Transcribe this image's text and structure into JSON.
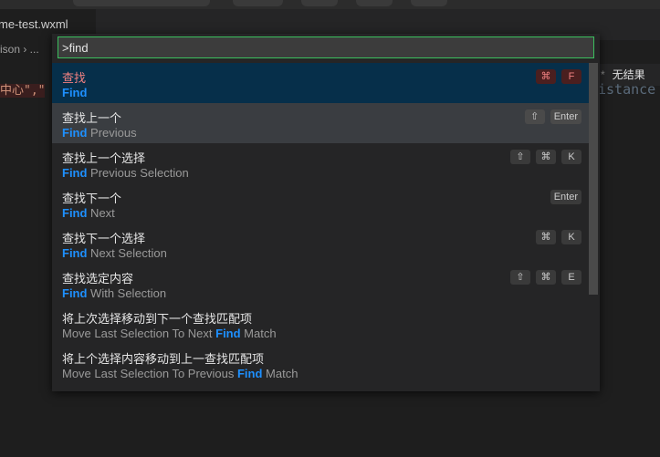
{
  "tab": {
    "label": "me-test.wxml"
  },
  "breadcrumb": {
    "label": "ison ›  ..."
  },
  "editor": {
    "code_fragment": "中心\",\"",
    "right_code": "istance"
  },
  "find_widget": {
    "no_result": "无结果"
  },
  "palette": {
    "query": ">find",
    "items": [
      {
        "title": "查找",
        "sub_prefix": "",
        "sub_hl": "Find",
        "sub_suffix": "",
        "keys": [
          "⌘",
          "F"
        ]
      },
      {
        "title": "查找上一个",
        "sub_prefix": "",
        "sub_hl": "Find",
        "sub_suffix": " Previous",
        "keys": [
          "⇧",
          "Enter"
        ]
      },
      {
        "title": "查找上一个选择",
        "sub_prefix": "",
        "sub_hl": "Find",
        "sub_suffix": " Previous Selection",
        "keys": [
          "⇧",
          "⌘",
          "K"
        ]
      },
      {
        "title": "查找下一个",
        "sub_prefix": "",
        "sub_hl": "Find",
        "sub_suffix": " Next",
        "keys": [
          "Enter"
        ]
      },
      {
        "title": "查找下一个选择",
        "sub_prefix": "",
        "sub_hl": "Find",
        "sub_suffix": " Next Selection",
        "keys": [
          "⌘",
          "K"
        ]
      },
      {
        "title": "查找选定内容",
        "sub_prefix": "",
        "sub_hl": "Find",
        "sub_suffix": " With Selection",
        "keys": [
          "⇧",
          "⌘",
          "E"
        ]
      },
      {
        "title": "将上次选择移动到下一个查找匹配项",
        "sub_prefix": "Move Last Selection To Next ",
        "sub_hl": "Find",
        "sub_suffix": " Match",
        "keys": []
      },
      {
        "title": "将上个选择内容移动到上一查找匹配项",
        "sub_prefix": "Move Last Selection To Previous ",
        "sub_hl": "Find",
        "sub_suffix": " Match",
        "keys": []
      }
    ]
  }
}
